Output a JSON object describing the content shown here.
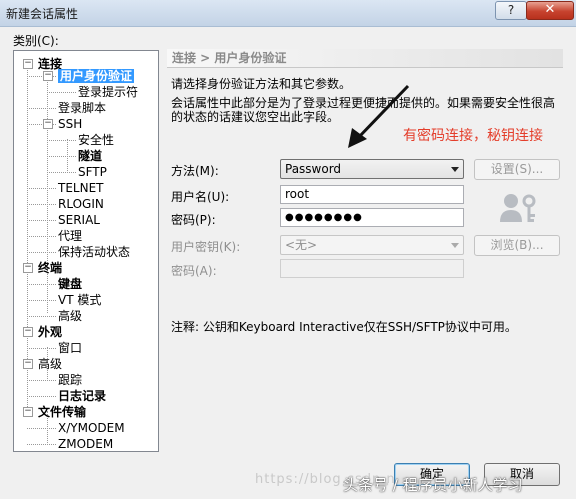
{
  "window": {
    "title": "新建会话属性",
    "help_label": "?",
    "close_label": "✕"
  },
  "category_label": "类别(C):",
  "tree": [
    {
      "label": "连接",
      "bold": true,
      "expander": "−"
    },
    {
      "label": "用户身份验证",
      "bold": true,
      "selected": true,
      "expander": "−"
    },
    {
      "label": "登录提示符"
    },
    {
      "label": "登录脚本"
    },
    {
      "label": "SSH",
      "expander": "−"
    },
    {
      "label": "安全性"
    },
    {
      "label": "隧道",
      "bold": true
    },
    {
      "label": "SFTP"
    },
    {
      "label": "TELNET"
    },
    {
      "label": "RLOGIN"
    },
    {
      "label": "SERIAL"
    },
    {
      "label": "代理"
    },
    {
      "label": "保持活动状态"
    },
    {
      "label": "终端",
      "bold": true,
      "expander": "−"
    },
    {
      "label": "键盘",
      "bold": true
    },
    {
      "label": "VT 模式"
    },
    {
      "label": "高级"
    },
    {
      "label": "外观",
      "bold": true,
      "expander": "−"
    },
    {
      "label": "窗口"
    },
    {
      "label": "高级",
      "expander": "−"
    },
    {
      "label": "跟踪"
    },
    {
      "label": "日志记录",
      "bold": true
    },
    {
      "label": "文件传输",
      "bold": true,
      "expander": "−"
    },
    {
      "label": "X/YMODEM"
    },
    {
      "label": "ZMODEM"
    }
  ],
  "panel": {
    "header": "连接 > 用户身份验证",
    "desc_line1": "请选择身份验证方法和其它参数。",
    "desc_line2": "会话属性中此部分是为了登录过程更便捷而提供的。如果需要安全性很高",
    "desc_line3": "的状态的话建议您空出此字段。",
    "method_label": "方法(M):",
    "method_value": "Password",
    "setup_button": "设置(S)...",
    "username_label": "用户名(U):",
    "username_value": "root",
    "password_label": "密码(P):",
    "password_value": "●●●●●●●●",
    "userkey_label": "用户密钥(K):",
    "userkey_value": "<无>",
    "browse_button": "浏览(B)...",
    "passphrase_label": "密码(A):",
    "note": "注释: 公钥和Keyboard Interactive仅在SSH/SFTP协议中可用。"
  },
  "annotation": "有密码连接，秘钥连接",
  "footer": {
    "ok_button": "确定",
    "cancel_button": "取消"
  },
  "watermark_blog": "https://blog.csdn.net/",
  "watermark_toutiao": "头条号 / 程序员小新人学习",
  "colors": {
    "selection": "#3399ff",
    "annotation": "#e43d2a"
  }
}
